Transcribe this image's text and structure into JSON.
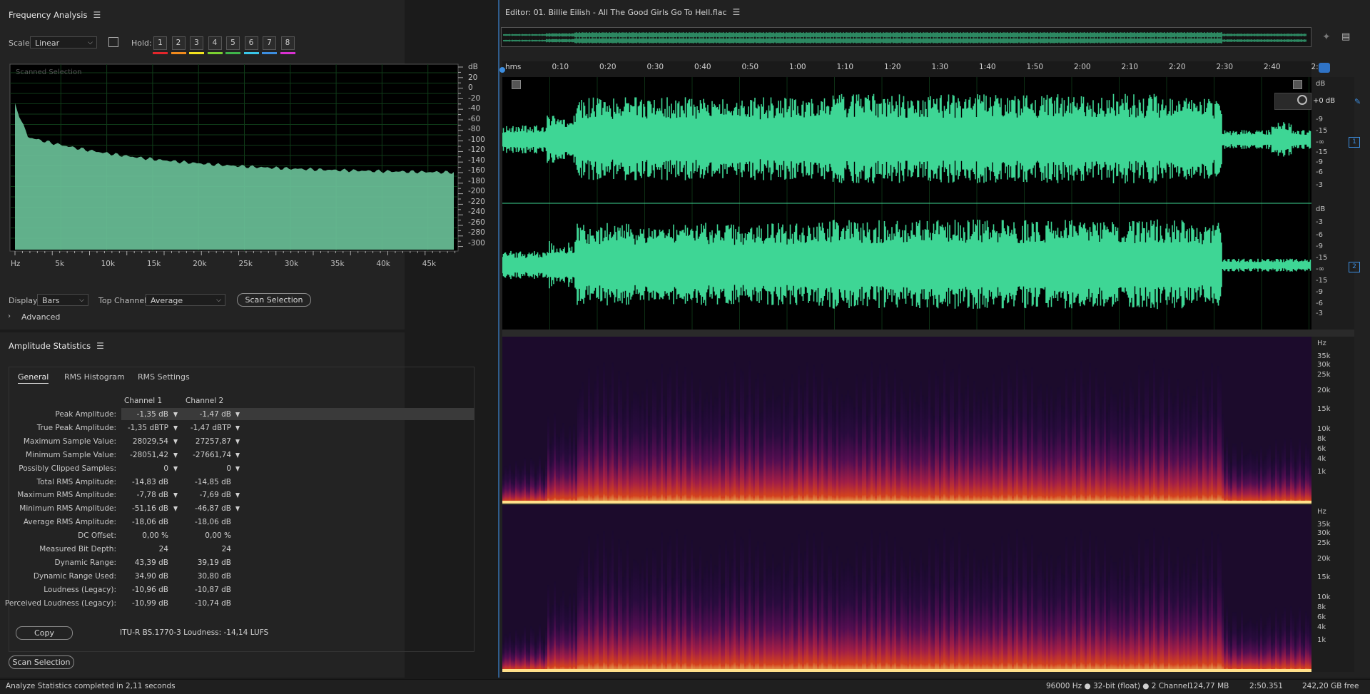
{
  "freq": {
    "title": "Frequency Analysis",
    "scale_label": "Scale:",
    "scale_value": "Linear",
    "hold_label": "Hold:",
    "holds": [
      "1",
      "2",
      "3",
      "4",
      "5",
      "6",
      "7",
      "8"
    ],
    "hold_colors": [
      "#e3262b",
      "#f08a1d",
      "#f2e21f",
      "#7bd131",
      "#3fb54a",
      "#39c6e8",
      "#3d8ee0",
      "#d931d1"
    ],
    "plot_label": "Scanned Selection",
    "db_axis": [
      "dB",
      "20",
      "0",
      "-20",
      "-40",
      "-60",
      "-80",
      "-100",
      "-120",
      "-140",
      "-160",
      "-180",
      "-200",
      "-220",
      "-240",
      "-260",
      "-280",
      "-300"
    ],
    "freq_axis": [
      "Hz",
      "5k",
      "10k",
      "15k",
      "20k",
      "25k",
      "30k",
      "35k",
      "40k",
      "45k"
    ],
    "display_label": "Display:",
    "display_value": "Bars",
    "top_channel_label": "Top Channel:",
    "top_channel_value": "Average",
    "scan_button": "Scan Selection",
    "advanced": "Advanced",
    "fill_color": "#6bc39a"
  },
  "amp": {
    "title": "Amplitude Statistics",
    "tabs": [
      "General",
      "RMS Histogram",
      "RMS Settings"
    ],
    "col_headers": [
      "Channel 1",
      "Channel 2"
    ],
    "rows": [
      {
        "label": "Peak Amplitude:",
        "c1": "-1,35 dB",
        "c2": "-1,47 dB",
        "m": true
      },
      {
        "label": "True Peak Amplitude:",
        "c1": "-1,35 dBTP",
        "c2": "-1,47 dBTP",
        "m": true
      },
      {
        "label": "Maximum Sample Value:",
        "c1": "28029,54",
        "c2": "27257,87",
        "m": true
      },
      {
        "label": "Minimum Sample Value:",
        "c1": "-28051,42",
        "c2": "-27661,74",
        "m": true
      },
      {
        "label": "Possibly Clipped Samples:",
        "c1": "0",
        "c2": "0",
        "m": true
      },
      {
        "label": "Total RMS Amplitude:",
        "c1": "-14,83 dB",
        "c2": "-14,85 dB",
        "m": false
      },
      {
        "label": "Maximum RMS Amplitude:",
        "c1": "-7,78 dB",
        "c2": "-7,69 dB",
        "m": true
      },
      {
        "label": "Minimum RMS Amplitude:",
        "c1": "-51,16 dB",
        "c2": "-46,87 dB",
        "m": true
      },
      {
        "label": "Average RMS Amplitude:",
        "c1": "-18,06 dB",
        "c2": "-18,06 dB",
        "m": false
      },
      {
        "label": "DC Offset:",
        "c1": "0,00 %",
        "c2": "0,00 %",
        "m": false
      },
      {
        "label": "Measured Bit Depth:",
        "c1": "24",
        "c2": "24",
        "m": false
      },
      {
        "label": "Dynamic Range:",
        "c1": "43,39 dB",
        "c2": "39,19 dB",
        "m": false
      },
      {
        "label": "Dynamic Range Used:",
        "c1": "34,90 dB",
        "c2": "30,80 dB",
        "m": false
      },
      {
        "label": "Loudness (Legacy):",
        "c1": "-10,96 dB",
        "c2": "-10,87 dB",
        "m": false
      },
      {
        "label": "Perceived Loudness (Legacy):",
        "c1": "-10,99 dB",
        "c2": "-10,74 dB",
        "m": false
      }
    ],
    "copy_button": "Copy",
    "lufs_text": "ITU-R BS.1770-3 Loudness: -14,14 LUFS",
    "scan_button": "Scan Selection"
  },
  "editor": {
    "title": "Editor: 01. Billie Eilish - All The Good Girls Go To Hell.flac",
    "time_labels": [
      "hms",
      "0:10",
      "0:20",
      "0:30",
      "0:40",
      "0:50",
      "1:00",
      "1:10",
      "1:20",
      "1:30",
      "1:40",
      "1:50",
      "2:00",
      "2:10",
      "2:20",
      "2:30",
      "2:40",
      "2:5"
    ],
    "wave_ruler": [
      "dB",
      "+0 dB",
      "-9",
      "-15",
      "-∞",
      "-15",
      "-9",
      "-6",
      "-3"
    ],
    "wave_ruler2": [
      "dB",
      "-3",
      "-6",
      "-9",
      "-15",
      "-∞",
      "-15",
      "-9",
      "-6",
      "-3"
    ],
    "channel_badges": [
      "1",
      "2"
    ],
    "spec_ruler": [
      "Hz",
      "35k",
      "30k",
      "25k",
      "20k",
      "15k",
      "10k",
      "8k",
      "6k",
      "4k",
      "1k"
    ],
    "wave_color": "#3ed695"
  },
  "status": {
    "left": "Analyze Statistics completed in 2,11 seconds",
    "sample_format": "96000 Hz ● 32-bit (float) ● 2 Channel",
    "size": "124,77 MB",
    "duration": "2:50.351",
    "free": "242,20 GB free"
  }
}
